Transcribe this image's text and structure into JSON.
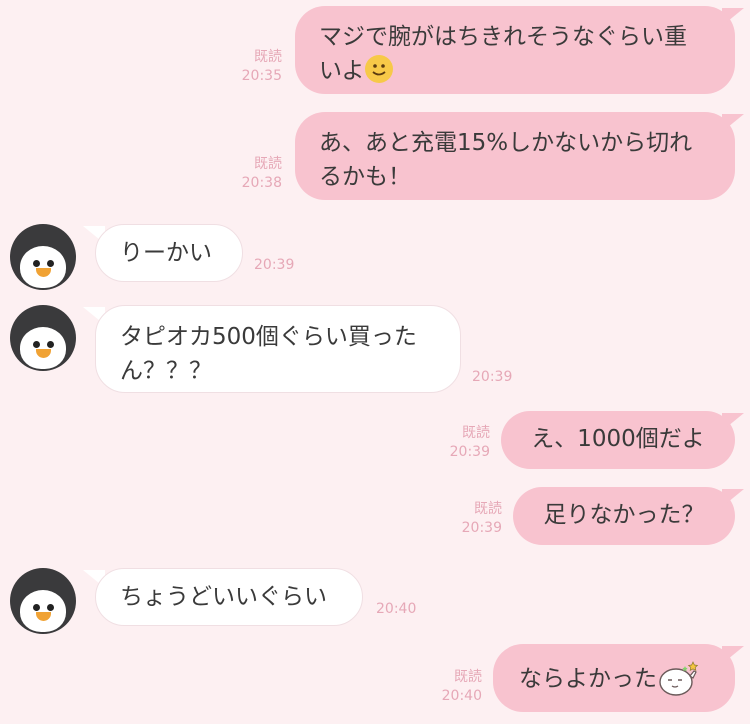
{
  "messages": [
    {
      "side": "out",
      "lines": [
        "マジで腕がはちきれそうなぐらい重",
        "いよ"
      ],
      "read": "既読",
      "time": "20:35",
      "emoji": "slightly-smiling-face-icon"
    },
    {
      "side": "out",
      "lines": [
        "あ、あと充電15%しかないから切れ",
        "るかも！"
      ],
      "read": "既読",
      "time": "20:38"
    },
    {
      "side": "in",
      "lines": [
        "りーかい"
      ],
      "time": "20:39"
    },
    {
      "side": "in",
      "lines": [
        "タピオカ500個ぐらい買った",
        "ん？？？"
      ],
      "time": "20:39"
    },
    {
      "side": "out",
      "lines": [
        "え、1000個だよ"
      ],
      "read": "既読",
      "time": "20:39"
    },
    {
      "side": "out",
      "lines": [
        "足りなかった？"
      ],
      "read": "既読",
      "time": "20:39"
    },
    {
      "side": "in",
      "lines": [
        "ちょうどいいぐらい"
      ],
      "time": "20:40"
    },
    {
      "side": "out",
      "lines": [
        "ならよかった"
      ],
      "read": "既読",
      "time": "20:40",
      "sticker": "thumbs-up-mochi-sticker-icon"
    }
  ],
  "colors": {
    "background": "#fdf0f2",
    "outgoing_bubble": "#f8c3cf",
    "incoming_bubble": "#ffffff",
    "meta_text": "#e6a8b7"
  },
  "avatar_icon": "penguin-avatar-icon"
}
